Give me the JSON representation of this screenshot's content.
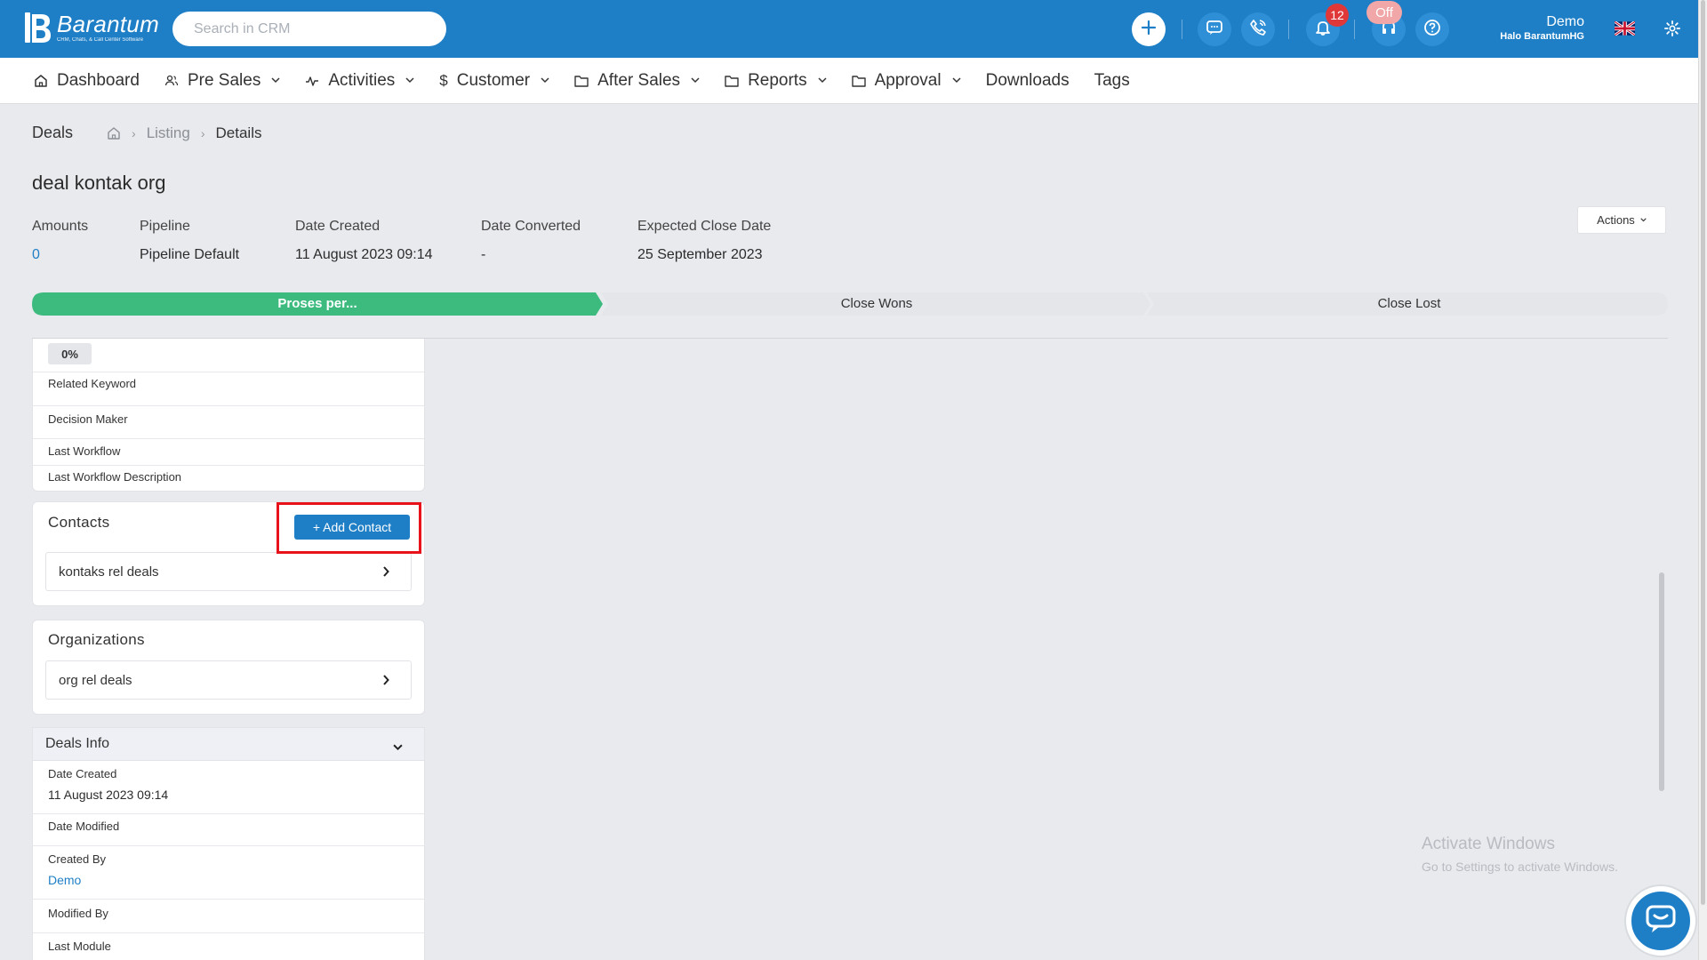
{
  "app": {
    "logo_name": "Barantum",
    "logo_tagline": "CRM, Chats, & Call Center Software",
    "search_placeholder": "Search in CRM",
    "notification_count": "12",
    "status_off": "Off",
    "user_name": "Demo",
    "user_sub": "Halo BarantumHG"
  },
  "nav": {
    "items": [
      {
        "label": "Dashboard",
        "icon": "home-icon",
        "dropdown": false
      },
      {
        "label": "Pre Sales",
        "icon": "users-icon",
        "dropdown": true
      },
      {
        "label": "Activities",
        "icon": "activity-icon",
        "dropdown": true
      },
      {
        "label": "Customer",
        "icon": "dollar-icon",
        "dropdown": true
      },
      {
        "label": "After Sales",
        "icon": "folder-icon",
        "dropdown": true
      },
      {
        "label": "Reports",
        "icon": "folder-icon",
        "dropdown": true
      },
      {
        "label": "Approval",
        "icon": "folder-icon",
        "dropdown": true
      },
      {
        "label": "Downloads",
        "icon": "",
        "dropdown": false
      },
      {
        "label": "Tags",
        "icon": "",
        "dropdown": false
      }
    ]
  },
  "breadcrumb": {
    "section": "Deals",
    "listing": "Listing",
    "current": "Details"
  },
  "deal": {
    "title": "deal kontak org",
    "actions_label": "Actions",
    "meta": [
      {
        "label": "Amounts",
        "value": "0"
      },
      {
        "label": "Pipeline",
        "value": "Pipeline Default"
      },
      {
        "label": "Date Created",
        "value": "11 August 2023 09:14"
      },
      {
        "label": "Date Converted",
        "value": "-"
      },
      {
        "label": "Expected Close Date",
        "value": "25 September 2023"
      }
    ]
  },
  "pipeline": {
    "stages": [
      "Proses per...",
      "Close Wons",
      "Close Lost"
    ],
    "active_color": "#3dbb7f",
    "inactive_color": "#e4e6ea"
  },
  "details": {
    "progress": "0%",
    "fields": [
      "Related Keyword",
      "Decision Maker",
      "Last Workflow",
      "Last Workflow Description"
    ]
  },
  "contacts": {
    "title": "Contacts",
    "add_label": "+ Add Contact",
    "items": [
      "kontaks rel deals"
    ]
  },
  "organizations": {
    "title": "Organizations",
    "items": [
      "org rel deals"
    ]
  },
  "deals_info": {
    "title": "Deals Info",
    "rows": [
      {
        "label": "Date Created",
        "value": "11 August 2023 09:14"
      },
      {
        "label": "Date Modified",
        "value": ""
      },
      {
        "label": "Created By",
        "value": "Demo"
      },
      {
        "label": "Modified By",
        "value": ""
      },
      {
        "label": "Last Module",
        "value": ""
      }
    ]
  },
  "watermark": {
    "line1": "Activate Windows",
    "line2": "Go to Settings to activate Windows."
  },
  "colors": {
    "brand": "#1f7fc6",
    "highlight": "#e8121b"
  }
}
